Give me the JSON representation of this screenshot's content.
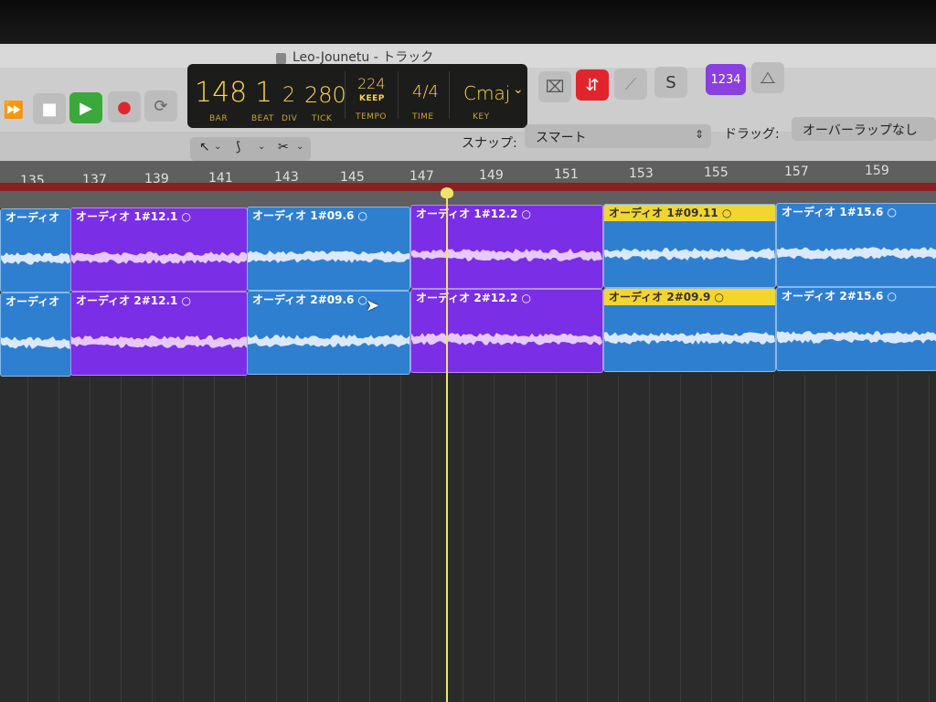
{
  "window": {
    "title": "Leo-Jounetu - トラック"
  },
  "transport": {
    "forward": "⏩",
    "stop": "■",
    "play": "▶",
    "record": "●",
    "cycle": "⟳"
  },
  "lcd": {
    "bar": "148",
    "bar_label": "BAR",
    "beat": "1",
    "beat_label": "BEAT",
    "div": "2",
    "div_label": "DIV",
    "tick": "280",
    "tick_label": "TICK",
    "tempo": "224",
    "tempo_mode": "KEEP",
    "tempo_label": "TEMPO",
    "time": "4/4",
    "time_label": "TIME",
    "key": "Cmaj",
    "key_label": "KEY"
  },
  "tools": {
    "solo_label": "S",
    "count_in_label": "1234"
  },
  "subtoolbar": {
    "snap_label": "スナップ:",
    "snap_value": "スマート",
    "drag_label": "ドラッグ:",
    "drag_value": "オーバーラップなし"
  },
  "ruler": {
    "bars": [
      "135",
      "137",
      "139",
      "141",
      "143",
      "145",
      "147",
      "149",
      "151",
      "153",
      "155",
      "157",
      "159"
    ]
  },
  "tracks": [
    {
      "regions": [
        {
          "name": "オーディオ",
          "color": "#2f7fd1"
        },
        {
          "name": "オーディオ 1#12.1",
          "color": "#7a2ee6"
        },
        {
          "name": "オーディオ 1#09.6",
          "color": "#2f7fd1"
        },
        {
          "name": "オーディオ 1#12.2",
          "color": "#7a2ee6"
        },
        {
          "name": "オーディオ 1#09.11",
          "color": "#2f7fd1",
          "yellow": true
        },
        {
          "name": "オーディオ 1#15.6",
          "color": "#2f7fd1"
        }
      ]
    },
    {
      "regions": [
        {
          "name": "オーディオ",
          "color": "#2f7fd1"
        },
        {
          "name": "オーディオ 2#12.1",
          "color": "#7a2ee6"
        },
        {
          "name": "オーディオ 2#09.6",
          "color": "#2f7fd1"
        },
        {
          "name": "オーディオ 2#12.2",
          "color": "#7a2ee6"
        },
        {
          "name": "オーディオ 2#09.9",
          "color": "#2f7fd1",
          "yellow": true
        },
        {
          "name": "オーディオ 2#15.6",
          "color": "#2f7fd1"
        }
      ]
    }
  ],
  "colors": {
    "accent_red": "#e0262c",
    "play_green": "#3aa83a",
    "purple_btn": "#8a3fe0",
    "playhead": "#f2e26a"
  }
}
